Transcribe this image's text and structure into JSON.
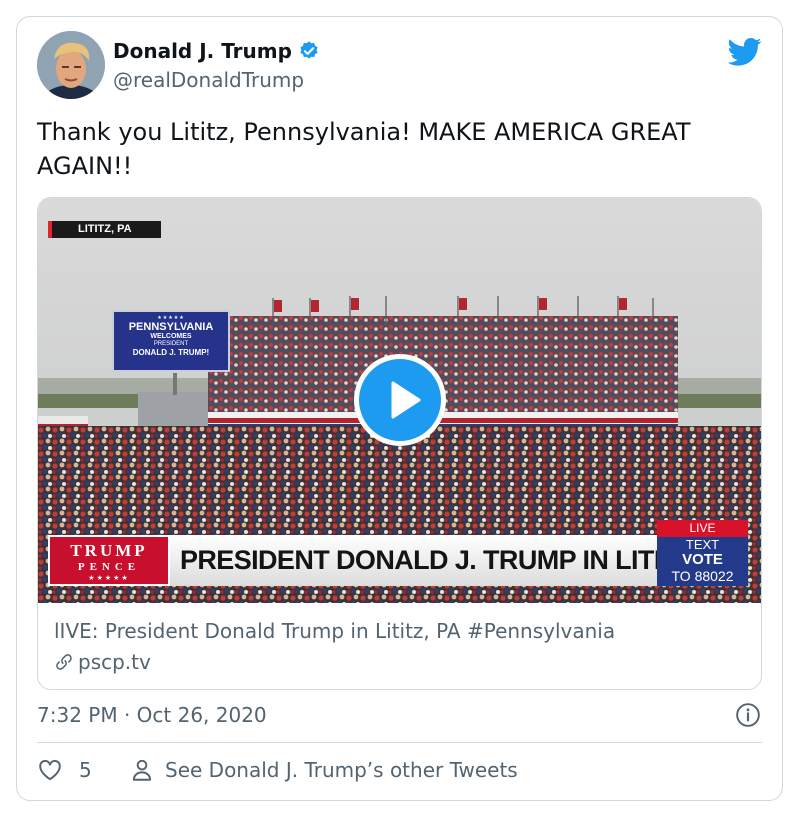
{
  "author": {
    "display_name": "Donald J. Trump",
    "handle": "@realDonaldTrump",
    "verified": true,
    "avatar_icon": "profile-photo"
  },
  "tweet": {
    "text": "Thank you Lititz, Pennsylvania! MAKE AMERICA GREAT AGAIN!!",
    "timestamp": "7:32 PM · Oct 26, 2020"
  },
  "media": {
    "location_tag": "LITITZ, PA",
    "billboard": {
      "stars": "★★★★★",
      "line1": "PENNSYLVANIA",
      "line2": "WELCOMES",
      "line3": "PRESIDENT",
      "line4": "DONALD J. TRUMP!"
    },
    "logo": {
      "line1": "TRUMP",
      "line2": "PENCE",
      "stars": "★★★★★"
    },
    "headline": "PRESIDENT DONALD J. TRUMP IN LITITZ, PA",
    "live_badge": "LIVE",
    "vote_box": {
      "line1": "TEXT",
      "line2": "VOTE",
      "line3": "TO 88022"
    }
  },
  "link_card": {
    "title": "lIVE: President Donald Trump in Lititz, PA #Pennsylvania",
    "domain": "pscp.tv"
  },
  "engagement": {
    "like_count": "5",
    "other_tweets_label": "See Donald J. Trump’s other Tweets"
  },
  "colors": {
    "twitter_blue": "#1d9bf0",
    "secondary_text": "#536471",
    "border": "#cfd9de",
    "broadcast_red": "#c8102e",
    "broadcast_blue": "#23398a"
  }
}
